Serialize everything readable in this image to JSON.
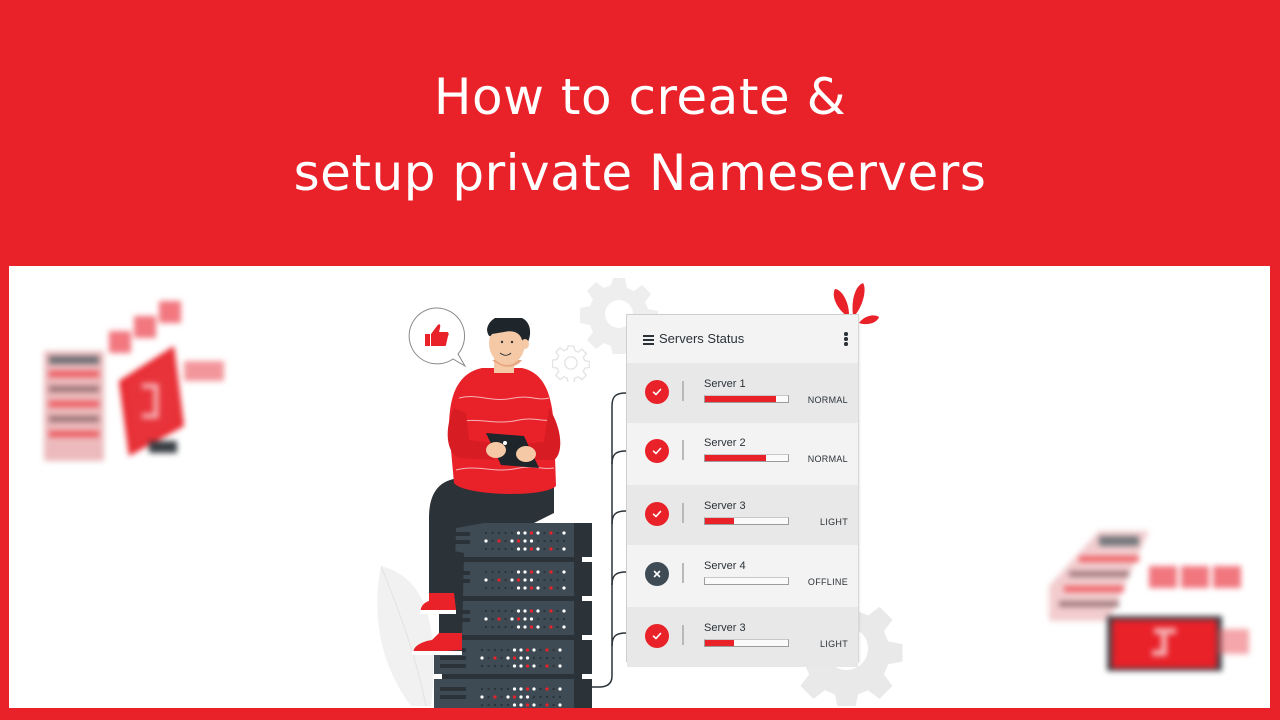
{
  "banner": {
    "title_line1": "How to create &",
    "title_line2": "setup private Nameservers",
    "background_color": "#e92129",
    "text_color": "#ffffff"
  },
  "illustration": {
    "speech_bubble_icon": "thumbs-up-icon",
    "person": "man-with-tablet",
    "server_rack_units": 5
  },
  "status_card": {
    "title": "Servers Status",
    "menu_icon": "hamburger-icon",
    "options_icon": "kebab-menu-icon",
    "servers": [
      {
        "name": "Server 1",
        "status": "NORMAL",
        "load_percent": 86,
        "state": "ok",
        "icon": "check-icon"
      },
      {
        "name": "Server 2",
        "status": "NORMAL",
        "load_percent": 74,
        "state": "ok",
        "icon": "check-icon"
      },
      {
        "name": "Server 3",
        "status": "LIGHT",
        "load_percent": 35,
        "state": "ok",
        "icon": "check-icon"
      },
      {
        "name": "Server 4",
        "status": "OFFLINE",
        "load_percent": 0,
        "state": "offline",
        "icon": "close-icon"
      },
      {
        "name": "Server 3",
        "status": "LIGHT",
        "load_percent": 35,
        "state": "ok",
        "icon": "check-icon"
      }
    ]
  },
  "colors": {
    "accent": "#e92129",
    "dark": "#2b3238",
    "offline": "#3e4b55",
    "card_bg": "#f3f3f3"
  }
}
